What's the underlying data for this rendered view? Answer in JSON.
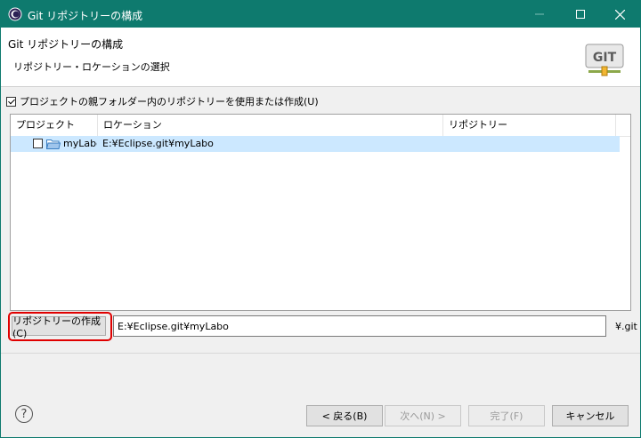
{
  "window": {
    "title": "Git リポジトリーの構成"
  },
  "header": {
    "title": "Git リポジトリーの構成",
    "subtitle": "リポジトリー・ロケーションの選択",
    "logo_text": "GIT"
  },
  "options": {
    "use_parent_folder_label": "プロジェクトの親フォルダー内のリポジトリーを使用または作成(U)",
    "use_parent_folder_checked": true
  },
  "table": {
    "columns": [
      "プロジェクト",
      "ロケーション",
      "リポジトリー"
    ],
    "rows": [
      {
        "project": "myLabo",
        "location": "E:¥Eclipse.git¥myLabo",
        "repository": "",
        "checked": false
      }
    ]
  },
  "create": {
    "button_label": "リポジトリーの作成(C)",
    "path_value": "E:¥Eclipse.git¥myLabo",
    "suffix": "¥.git"
  },
  "footer": {
    "back_label": "< 戻る(B)",
    "next_label": "次へ(N) >",
    "finish_label": "完了(F)",
    "cancel_label": "キャンセル"
  },
  "colors": {
    "titlebar": "#0e7a6e",
    "selection": "#cce8ff",
    "highlight": "#e00000"
  }
}
